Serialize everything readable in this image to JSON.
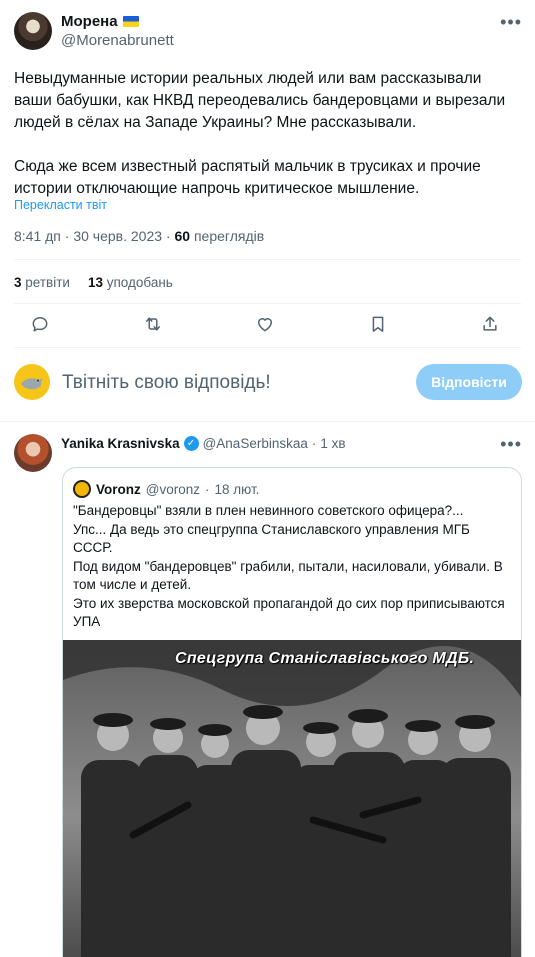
{
  "tweet": {
    "author_name": "Морена",
    "author_handle": "@Morenabrunett",
    "text_p1": "Невыдуманные истории реальных людей или вам рассказывали ваши бабушки, как НКВД переодевались бандеровцами и вырезали людей в сёлах на Западе Украины? Мне рассказывали.",
    "text_p2": "Сюда же всем известный распятый мальчик в трусиках и прочие истории отключающие напрочь критическое мышление.",
    "translate_label": "Перекласти твіт",
    "time": "8:41 дп",
    "date": "30 черв. 2023",
    "views_count": "60",
    "views_label": "переглядів",
    "retweets_count": "3",
    "retweets_label": "ретвіти",
    "likes_count": "13",
    "likes_label": "уподобань"
  },
  "actions": [
    "reply-icon",
    "retweet-icon",
    "like-icon",
    "bookmark-icon",
    "share-icon"
  ],
  "reply_box": {
    "placeholder": "Твітніть свою відповідь!",
    "button_label": "Відповісти"
  },
  "reply": {
    "author_name": "Yanika Krasnivska",
    "author_handle": "@AnaSerbinskaa",
    "time": "1 хв",
    "quote": {
      "author_name": "Voronz",
      "author_handle": "@voronz",
      "date": "18 лют.",
      "line1": "\"Бандеровцы\" взяли в плен невинного советского офицера?...",
      "line2": "Упс... Да ведь это спецгруппа Станиславского управления МГБ СССР.",
      "line3": "Под видом \"бандеровцев\" грабили, пытали, насиловали, убивали. В том числе и детей.",
      "line4": "Это их зверства московской пропагандой до сих пор приписываются УПА",
      "photo_caption": "Спецгрупа Станіславівського МДБ."
    }
  },
  "colors": {
    "accent": "#1d9bf0",
    "reply_button": "#8ecdf8",
    "muted": "#536471"
  }
}
